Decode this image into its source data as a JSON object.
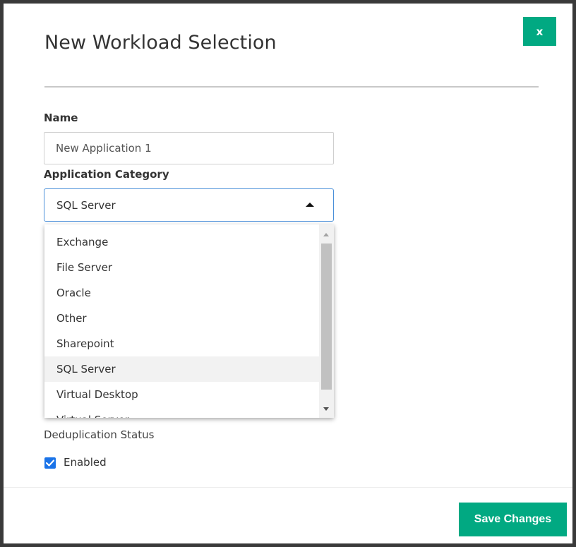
{
  "dialog": {
    "title": "New Workload Selection",
    "close_label": "x"
  },
  "form": {
    "name_label": "Name",
    "name_value": "New Application 1",
    "category_label": "Application Category",
    "category_value": "SQL Server",
    "category_options": [
      "Exchange",
      "File Server",
      "Oracle",
      "Other",
      "Sharepoint",
      "SQL Server",
      "Virtual Desktop",
      "Virtual Server"
    ],
    "dedup_label": "Deduplication Status",
    "enabled_label": "Enabled",
    "enabled_checked": true
  },
  "footer": {
    "save_label": "Save Changes"
  },
  "icons": {
    "caret": "caret-up-icon",
    "check": "checkmark-icon"
  },
  "colors": {
    "accent": "#01a982",
    "focus_border": "#4a90d9",
    "checkbox": "#1a73e8"
  }
}
